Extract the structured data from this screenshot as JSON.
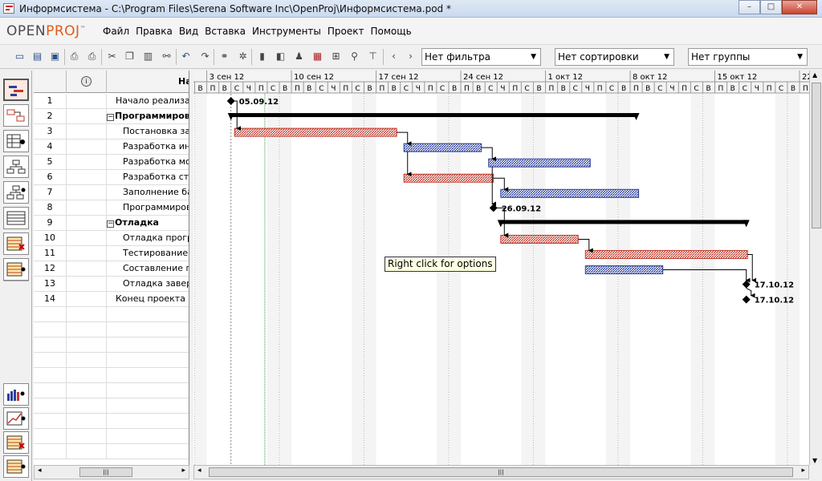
{
  "window": {
    "title": "Информсистема - C:\\Program Files\\Serena Software Inc\\OpenProj\\Информсистема.pod *",
    "minimize": "–",
    "maximize": "□",
    "close": "✕"
  },
  "logo": {
    "open": "OPEN",
    "proj": "PROJ",
    "tm": "™"
  },
  "menu": [
    "Файл",
    "Правка",
    "Вид",
    "Вставка",
    "Инструменты",
    "Проект",
    "Помощь"
  ],
  "toolbar": {
    "filter": "Нет фильтра",
    "sort": "Нет сортировки",
    "group": "Нет группы"
  },
  "table": {
    "name_header": "Наименование",
    "rows": [
      {
        "id": "1",
        "name": "Начало реализации",
        "level": 1,
        "summary": false
      },
      {
        "id": "2",
        "name": "Программирование",
        "level": 0,
        "summary": true
      },
      {
        "id": "3",
        "name": "Постановка задачи",
        "level": 2,
        "summary": false
      },
      {
        "id": "4",
        "name": "Разработка интерфейса",
        "level": 2,
        "summary": false
      },
      {
        "id": "5",
        "name": "Разработка модулей",
        "level": 2,
        "summary": false
      },
      {
        "id": "6",
        "name": "Разработка структуры",
        "level": 2,
        "summary": false
      },
      {
        "id": "7",
        "name": "Заполнение базы",
        "level": 2,
        "summary": false
      },
      {
        "id": "8",
        "name": "Программирование завершено",
        "level": 2,
        "summary": false
      },
      {
        "id": "9",
        "name": "Отладка",
        "level": 0,
        "summary": true
      },
      {
        "id": "10",
        "name": "Отладка программы",
        "level": 2,
        "summary": false
      },
      {
        "id": "11",
        "name": "Тестирование интерфейса",
        "level": 2,
        "summary": false
      },
      {
        "id": "12",
        "name": "Составление программы",
        "level": 2,
        "summary": false
      },
      {
        "id": "13",
        "name": "Отладка завершена",
        "level": 2,
        "summary": false
      },
      {
        "id": "14",
        "name": "Конец проекта",
        "level": 1,
        "summary": false
      }
    ]
  },
  "timescale": {
    "weeks": [
      "3 сен 12",
      "10 сен 12",
      "17 сен 12",
      "24 сен 12",
      "1 окт 12",
      "8 окт 12",
      "15 окт 12",
      "22"
    ],
    "days": [
      "В",
      "П",
      "В",
      "С",
      "Ч",
      "П",
      "С"
    ]
  },
  "gantt": {
    "colors": {
      "red": "#c0392b",
      "blue": "#2c3e9a",
      "summary": "#000000"
    },
    "milestone_labels": {
      "t1": "05.09.12",
      "t8": "26.09.12",
      "t13": "17.10.12",
      "t14": "17.10.12"
    },
    "tooltip": "Right click for options"
  }
}
